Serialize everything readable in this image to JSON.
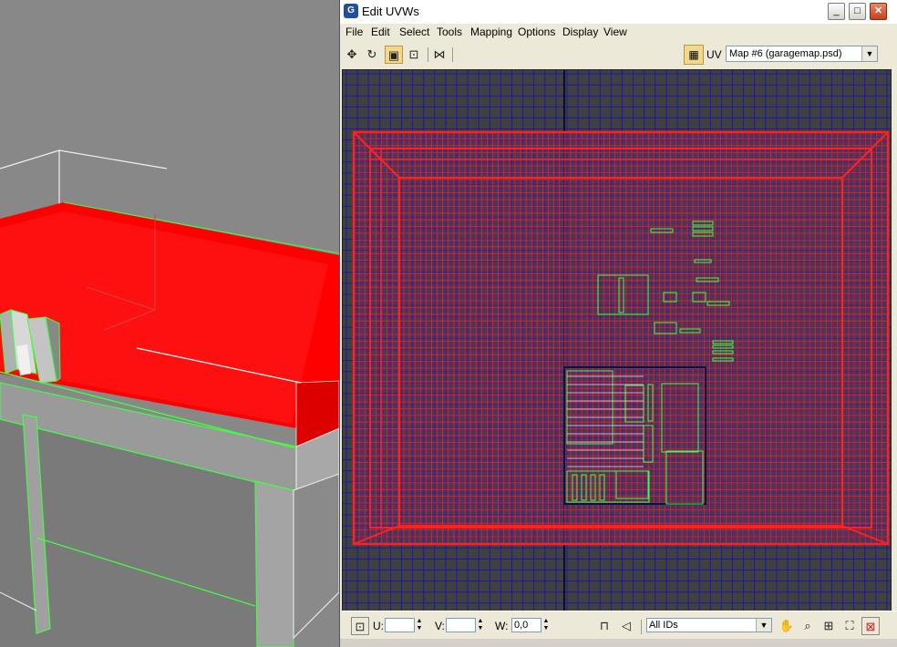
{
  "window": {
    "title": "Edit UVWs",
    "app_icon": "G",
    "minimize_label": "_",
    "maximize_label": "□",
    "close_label": "✕"
  },
  "menu": [
    "File",
    "Edit",
    "Select",
    "Tools",
    "Mapping",
    "Options",
    "Display",
    "View"
  ],
  "toolbar": {
    "tools": [
      {
        "name": "move-tool-icon",
        "glyph": "✥"
      },
      {
        "name": "rotate-tool-icon",
        "glyph": "↻"
      },
      {
        "name": "scale-tool-icon",
        "glyph": "▣"
      },
      {
        "name": "freeform-tool-icon",
        "glyph": "⊡"
      },
      {
        "name": "mirror-tool-icon",
        "glyph": "⋈"
      }
    ],
    "uv_label": "UV",
    "map_select": "Map #6 (garagemap.psd)"
  },
  "status": {
    "u_label": "U:",
    "u_value": "",
    "v_label": "V:",
    "v_value": "",
    "w_label": "W:",
    "w_value": "0,0",
    "ids_select": "All IDs"
  },
  "colors": {
    "grid_line": "#1a1aa0",
    "uv_edge_red": "#ff2020",
    "uv_select_green": "#40ff40",
    "object_red": "#ff0000",
    "viewport_bg": "#888888"
  }
}
